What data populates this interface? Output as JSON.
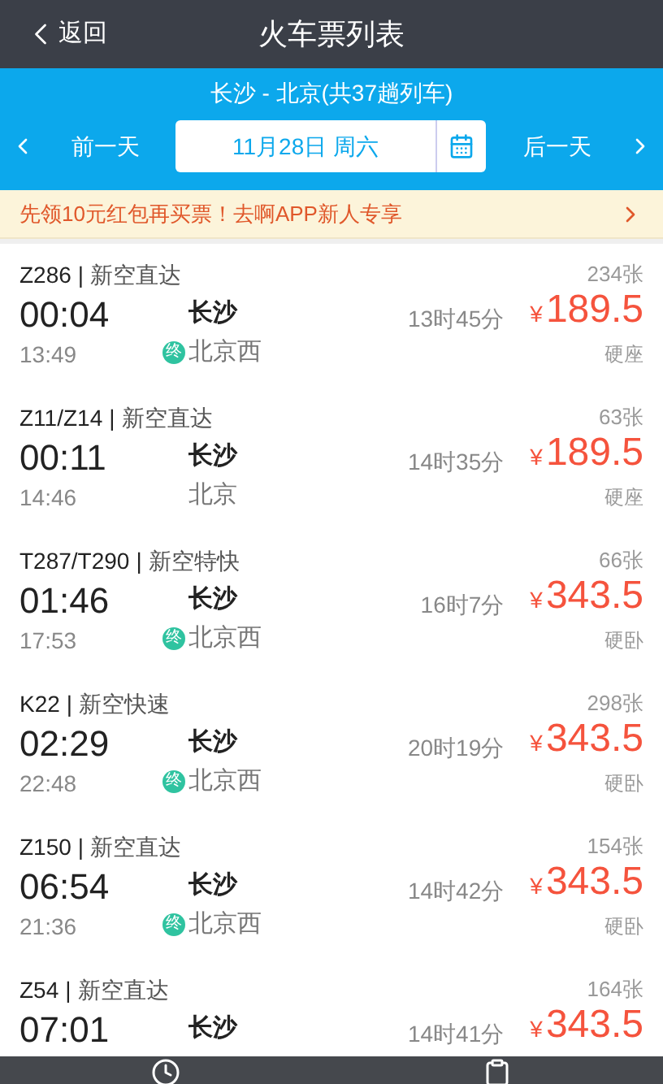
{
  "header": {
    "back": "返回",
    "title": "火车票列表"
  },
  "route": "长沙 - 北京(共37趟列车)",
  "date_bar": {
    "prev": "前一天",
    "date": "11月28日 周六",
    "next": "后一天"
  },
  "promo": "先领10元红包再买票！去啊APP新人专享",
  "trains": [
    {
      "train": "Z286",
      "separator": "|",
      "type": "新空直达",
      "depart": "00:04",
      "arrive": "13:49",
      "from": "长沙",
      "to": "北京西",
      "badge": "终",
      "duration": "13时45分",
      "price": "189.5",
      "currency": "¥",
      "tickets": "234张",
      "seat": "硬座"
    },
    {
      "train": "Z11/Z14",
      "separator": "|",
      "type": "新空直达",
      "depart": "00:11",
      "arrive": "14:46",
      "from": "长沙",
      "to": "北京",
      "duration": "14时35分",
      "price": "189.5",
      "currency": "¥",
      "tickets": "63张",
      "seat": "硬座"
    },
    {
      "train": "T287/T290",
      "separator": "|",
      "type": "新空特快",
      "depart": "01:46",
      "arrive": "17:53",
      "from": "长沙",
      "to": "北京西",
      "badge": "终",
      "duration": "16时7分",
      "price": "343.5",
      "currency": "¥",
      "tickets": "66张",
      "seat": "硬卧"
    },
    {
      "train": "K22",
      "separator": "|",
      "type": "新空快速",
      "depart": "02:29",
      "arrive": "22:48",
      "from": "长沙",
      "to": "北京西",
      "badge": "终",
      "duration": "20时19分",
      "price": "343.5",
      "currency": "¥",
      "tickets": "298张",
      "seat": "硬卧"
    },
    {
      "train": "Z150",
      "separator": "|",
      "type": "新空直达",
      "depart": "06:54",
      "arrive": "21:36",
      "from": "长沙",
      "to": "北京西",
      "badge": "终",
      "duration": "14时42分",
      "price": "343.5",
      "currency": "¥",
      "tickets": "154张",
      "seat": "硬卧"
    },
    {
      "train": "Z54",
      "separator": "|",
      "type": "新空直达",
      "depart": "07:01",
      "from": "长沙",
      "duration": "14时41分",
      "price": "343.5",
      "currency": "¥",
      "tickets": "164张"
    }
  ]
}
